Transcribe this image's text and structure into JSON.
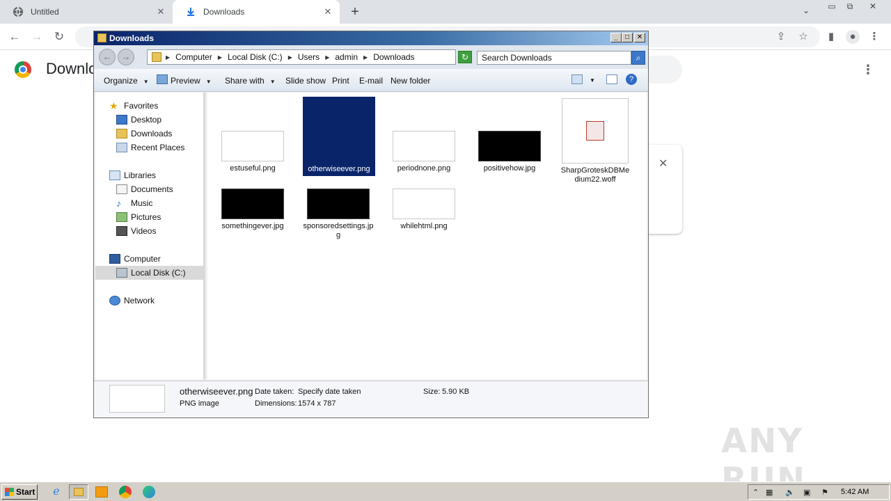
{
  "browser": {
    "tabs": [
      {
        "label": "Untitled",
        "icon": "globe-icon"
      },
      {
        "label": "Downloads",
        "icon": "download-icon"
      }
    ],
    "page_title": "Downloads"
  },
  "explorer": {
    "title": "Downloads",
    "breadcrumbs": [
      "Computer",
      "Local Disk (C:)",
      "Users",
      "admin",
      "Downloads"
    ],
    "search_placeholder": "Search Downloads",
    "commands": {
      "organize": "Organize",
      "preview": "Preview",
      "share_with": "Share with",
      "slide_show": "Slide show",
      "print": "Print",
      "email": "E-mail",
      "new_folder": "New folder"
    },
    "nav": {
      "favorites": "Favorites",
      "desktop": "Desktop",
      "downloads": "Downloads",
      "recent_places": "Recent Places",
      "libraries": "Libraries",
      "documents": "Documents",
      "music": "Music",
      "pictures": "Pictures",
      "videos": "Videos",
      "computer": "Computer",
      "local_disk": "Local Disk (C:)",
      "network": "Network"
    },
    "files": [
      {
        "name": "estuseful.png",
        "thumb": "white"
      },
      {
        "name": "otherwiseever.png",
        "thumb": "navy",
        "selected": true
      },
      {
        "name": "periodnone.png",
        "thumb": "white"
      },
      {
        "name": "positivehow.jpg",
        "thumb": "black"
      },
      {
        "name": "SharpGroteskDBMedium22.woff",
        "thumb": "font"
      },
      {
        "name": "somethingever.jpg",
        "thumb": "black"
      },
      {
        "name": "sponsoredsettings.jpg",
        "thumb": "black"
      },
      {
        "name": "whilehtml.png",
        "thumb": "white"
      }
    ],
    "details": {
      "filename": "otherwiseever.png",
      "type": "PNG image",
      "date_taken_label": "Date taken:",
      "date_taken_value": "Specify date taken",
      "dimensions_label": "Dimensions:",
      "dimensions_value": "1574 x 787",
      "size_label": "Size:",
      "size_value": "5.90 KB"
    }
  },
  "taskbar": {
    "start_label": "Start",
    "clock": "5:42 AM"
  },
  "watermark": "ANY RUN",
  "colors": {
    "selection": "#0a246a",
    "titlebar": "#0a246a",
    "taskbar": "#d4d0c8"
  }
}
